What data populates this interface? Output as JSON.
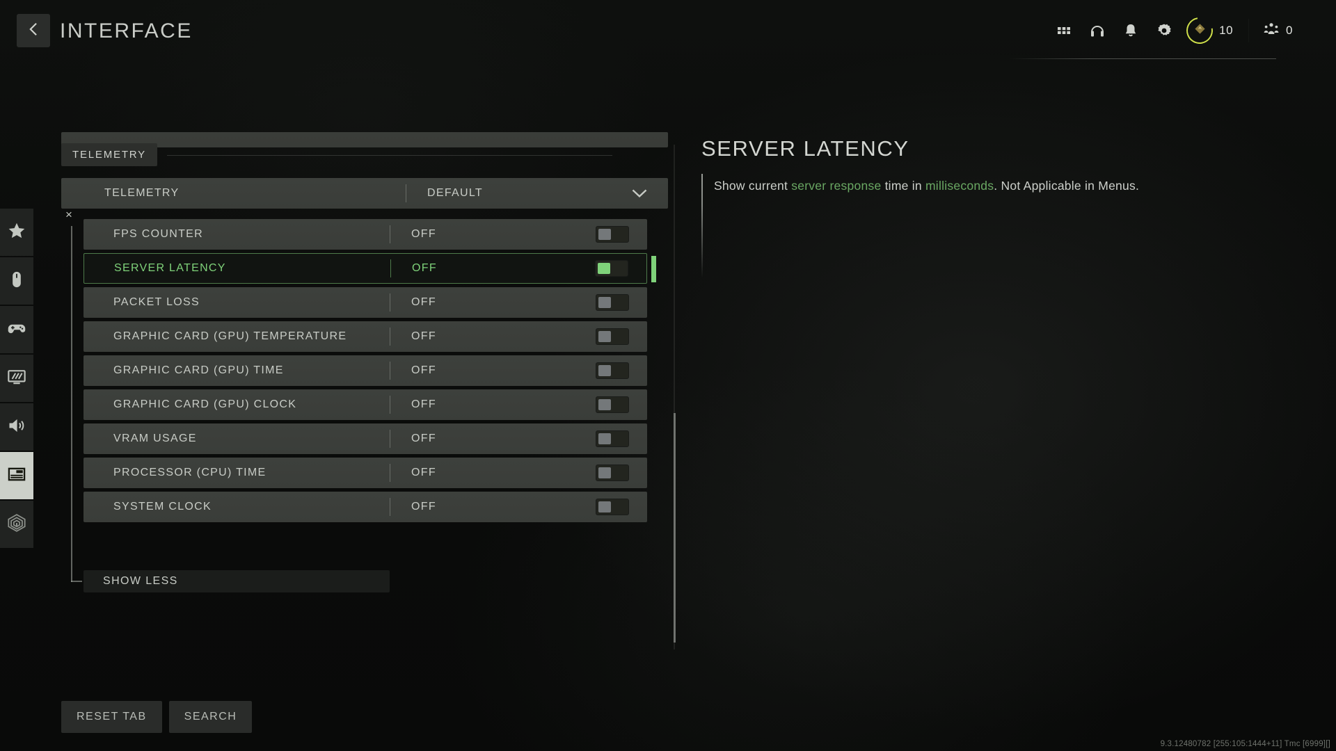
{
  "header": {
    "back_icon": "chevron-left-icon",
    "title": "INTERFACE",
    "icons": [
      {
        "name": "apps-grid-icon",
        "label": "Apps"
      },
      {
        "name": "headphones-icon",
        "label": "Audio Chat"
      },
      {
        "name": "bell-icon",
        "label": "Notifications"
      },
      {
        "name": "gear-icon",
        "label": "Settings"
      }
    ],
    "currency": {
      "icon": "diamond-token-icon",
      "amount": "10",
      "ring_color": "#cfe04a"
    },
    "squad": {
      "icon": "squad-icon",
      "count": "0"
    }
  },
  "sidebar": {
    "items": [
      {
        "name": "favorites",
        "icon": "star-icon",
        "active": false
      },
      {
        "name": "mouse-keyboard",
        "icon": "mouse-icon",
        "active": false
      },
      {
        "name": "controller",
        "icon": "gamepad-icon",
        "active": false
      },
      {
        "name": "graphics",
        "icon": "monitor-icon",
        "active": false
      },
      {
        "name": "audio",
        "icon": "speaker-icon",
        "active": false
      },
      {
        "name": "interface",
        "icon": "interface-layout-icon",
        "active": true
      },
      {
        "name": "broadcast",
        "icon": "broadcast-icon",
        "active": false
      }
    ]
  },
  "settings": {
    "section_label": "TELEMETRY",
    "parent_row": {
      "label": "TELEMETRY",
      "value": "DEFAULT",
      "control": "dropdown",
      "chevron": "chevron-down-icon"
    },
    "group_marker": "×",
    "rows": [
      {
        "label": "FPS COUNTER",
        "value": "OFF",
        "toggle": "off",
        "selected": false
      },
      {
        "label": "SERVER LATENCY",
        "value": "OFF",
        "toggle": "off",
        "selected": true
      },
      {
        "label": "PACKET LOSS",
        "value": "OFF",
        "toggle": "off",
        "selected": false
      },
      {
        "label": "GRAPHIC CARD (GPU) TEMPERATURE",
        "value": "OFF",
        "toggle": "off",
        "selected": false
      },
      {
        "label": "GRAPHIC CARD (GPU) TIME",
        "value": "OFF",
        "toggle": "off",
        "selected": false
      },
      {
        "label": "GRAPHIC CARD (GPU) CLOCK",
        "value": "OFF",
        "toggle": "off",
        "selected": false
      },
      {
        "label": "VRAM USAGE",
        "value": "OFF",
        "toggle": "off",
        "selected": false
      },
      {
        "label": "PROCESSOR (CPU) TIME",
        "value": "OFF",
        "toggle": "off",
        "selected": false
      },
      {
        "label": "SYSTEM CLOCK",
        "value": "OFF",
        "toggle": "off",
        "selected": false
      }
    ],
    "show_less": "SHOW LESS"
  },
  "detail": {
    "title": "SERVER LATENCY",
    "desc_part1": "Show current ",
    "desc_hl1": "server response",
    "desc_part2": " time in ",
    "desc_hl2": "milliseconds",
    "desc_part3": ". Not Applicable in Menus."
  },
  "footer": {
    "reset_tab": "RESET TAB",
    "search": "SEARCH",
    "version": "9.3.12480782 [255:105:1444+11] Tmc [6999][]"
  },
  "colors": {
    "accent_green": "#7fd27a",
    "desc_green": "#6aa863",
    "currency_ring": "#cfe04a"
  }
}
